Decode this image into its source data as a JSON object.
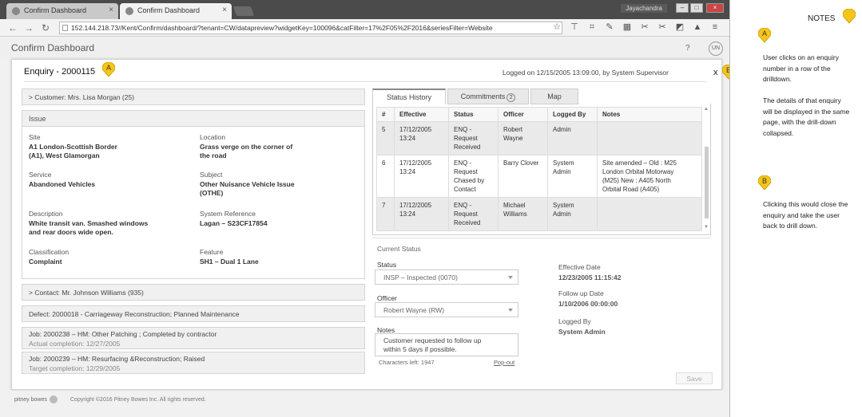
{
  "browser": {
    "tabs": [
      {
        "label": "Confirm Dashboard"
      },
      {
        "label": "Confirm Dashboard"
      }
    ],
    "user": "Jayachandra",
    "url": "152.144.218.73//Kent/Confirm/dashboard/?tenant=CW/datapreview?widgetKey=100096&catFilter=17%2F05%2F2016&seriesFilter=Website"
  },
  "app": {
    "title": "Confirm Dashboard",
    "help": "?",
    "user_initials": "UN"
  },
  "enquiry": {
    "title": "Enquiry - 2000115",
    "logged": "Logged on 12/15/2005 13:09:00,  by System Supervisor",
    "close": "x"
  },
  "left": {
    "customer": "> Customer: Mrs. Lisa Morgan (25)",
    "issue_title": "Issue",
    "fields": [
      {
        "label": "Site",
        "value": "A1 London-Scottish Border\n(A1), West Glamorgan"
      },
      {
        "label": "Location",
        "value": "Grass verge on the corner of\nthe road"
      },
      {
        "label": "Service",
        "value": "Abandoned Vehicles"
      },
      {
        "label": "Subject",
        "value": "Other Nuisance Vehicle Issue\n(OTHE)"
      },
      {
        "label": "Description",
        "value": "White transit van. Smashed windows\nand rear doors wide open."
      },
      {
        "label": "System Reference",
        "value": "Lagan – S23CF17854"
      },
      {
        "label": "Classification",
        "value": "Complaint"
      },
      {
        "label": "Feature",
        "value": "SH1 – Dual 1 Lane"
      }
    ],
    "contact": "> Contact: Mr. Johnson Williams (935)",
    "defect": "Defect: 2000018 - Carriageway Reconstruction;  Planned Maintenance",
    "jobs": [
      {
        "title": "Job: 2000238 – HM: Other Patching ; Completed by contractor",
        "sub": "Actual completion: 12/27/2005"
      },
      {
        "title": "Job: 2000239 – HM: Resurfacing &Reconstruction; Raised",
        "sub": "Target completion: 12/29/2005"
      }
    ]
  },
  "right": {
    "tabs": [
      "Status History",
      "Commitments",
      "Map"
    ],
    "commitments_count": "2",
    "columns": [
      "#",
      "Effective",
      "Status",
      "Officer",
      "Logged By",
      "Notes"
    ],
    "rows": [
      {
        "num": "5",
        "effective": "17/12/2005\n13:24",
        "status": "ENQ -\nRequest\nReceived",
        "officer": "Robert\nWayne",
        "logged_by": "Admin",
        "notes": ""
      },
      {
        "num": "6",
        "effective": "17/12/2005\n13:24",
        "status": "ENQ -\nRequest\nChased by\nContact",
        "officer": "Barry Clover",
        "logged_by": "System\nAdmin",
        "notes": "Site amended – Old : M25\nLondon Orbital Motorway\n(M25) New : A405 North\nOrbital Road (A405)"
      },
      {
        "num": "7",
        "effective": "17/12/2005\n13:24",
        "status": "ENQ -\nRequest\nReceived",
        "officer": "Michael\nWilliams",
        "logged_by": "System\nAdmin",
        "notes": ""
      }
    ],
    "current_status": {
      "title": "Current Status",
      "status_label": "Status",
      "status_value": "INSP – Inspected (0070)",
      "officer_label": "Officer",
      "officer_value": "Robert Wayne (RW)",
      "notes_label": "Notes",
      "notes_value": "Customer requested to follow up\nwithin 5 days if possible.",
      "chars_left": "Characters left: 1947",
      "popout": "Pop-out",
      "effective_label": "Effective Date",
      "effective_value": "12/23/2005  11:15:42",
      "followup_label": "Follow up Date",
      "followup_value": "1/10/2006  00:00:00",
      "loggedby_label": "Logged By",
      "loggedby_value": "System Admin"
    },
    "save": "Save"
  },
  "footer": {
    "brand": "pitney bowes",
    "copyright": "Copyright ©2016 Pitney Bowes Inc. All rights reserved."
  },
  "notes": {
    "title": "NOTES",
    "marker_a": "A",
    "marker_b": "B",
    "note_a": "User clicks on an enquiry number in a row of the drilldown.\n\nThe details of that enquiry will be displayed in the same page, with the drill-down collapsed.",
    "note_b": "Clicking this would close the enquiry and take the user back to drill down."
  },
  "colors": {
    "marker": "#f5c518",
    "marker_stroke": "#c99a00"
  }
}
